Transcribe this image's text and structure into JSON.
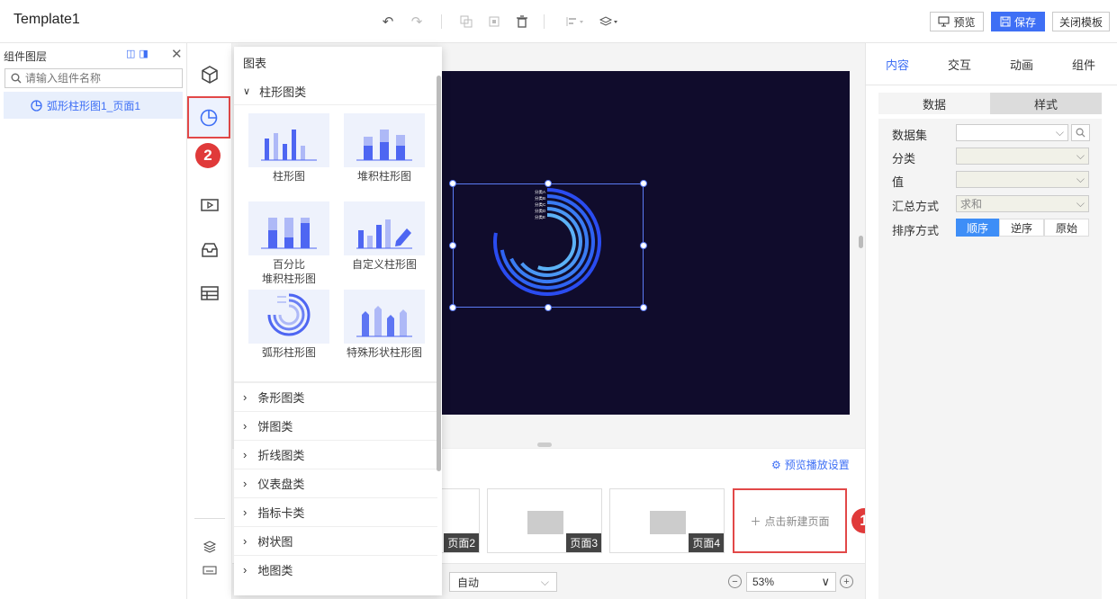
{
  "app": {
    "title": "Template1"
  },
  "header": {
    "undo": "↶",
    "redo": "↷",
    "buttons": {
      "preview": "预览",
      "save": "保存",
      "close": "关闭模板"
    }
  },
  "layers": {
    "title": "组件图层",
    "search_placeholder": "请输入组件名称",
    "items": [
      {
        "label": "弧形柱形图1_页面1"
      }
    ]
  },
  "badges": {
    "one": "1",
    "two": "2"
  },
  "chart_panel": {
    "title": "图表",
    "section": "柱形图类",
    "charts": [
      {
        "label": "柱形图"
      },
      {
        "label": "堆积柱形图"
      },
      {
        "label": "百分比\n堆积柱形图"
      },
      {
        "label": "自定义柱形图"
      },
      {
        "label": "弧形柱形图"
      },
      {
        "label": "特殊形状柱形图"
      }
    ],
    "categories": [
      "条形图类",
      "饼图类",
      "折线图类",
      "仪表盘类",
      "指标卡类",
      "树状图",
      "地图类"
    ]
  },
  "stage": {
    "legend": [
      "分类A",
      "分类B",
      "分类C",
      "分类D",
      "分类E"
    ],
    "arc_colors": [
      "#2a4cf0",
      "#2f63f2",
      "#3a7cf3",
      "#4a96f4",
      "#5cb2f6"
    ]
  },
  "pages": {
    "play_settings": "预览播放设置",
    "thumbs": [
      {
        "label": "页面2"
      },
      {
        "label": "页面3"
      },
      {
        "label": "页面4"
      }
    ],
    "new_page": "点击新建页面",
    "auto": "自动",
    "zoom": "53%"
  },
  "right": {
    "tabs": [
      "内容",
      "交互",
      "动画",
      "组件"
    ],
    "active_tab": "内容",
    "subtabs": [
      "数据",
      "样式"
    ],
    "fields": {
      "dataset": "数据集",
      "category": "分类",
      "value": "值",
      "summary": "汇总方式",
      "summary_value": "求和",
      "sort": "排序方式"
    },
    "sort_options": [
      "顺序",
      "逆序",
      "原始"
    ],
    "accent": "#3e6ff5"
  }
}
